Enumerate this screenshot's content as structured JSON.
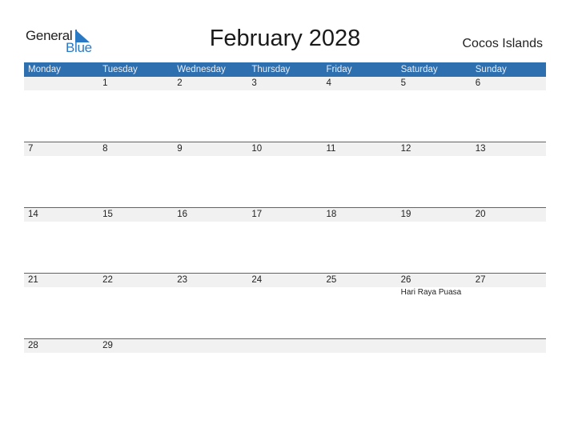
{
  "logo": {
    "word1": "General",
    "word2": "Blue"
  },
  "header": {
    "title": "February 2028",
    "country": "Cocos Islands"
  },
  "colors": {
    "accent": "#2E6FB0",
    "strip": "#f1f1f1",
    "logo_blue": "#2a79c4"
  },
  "weekdays": [
    "Monday",
    "Tuesday",
    "Wednesday",
    "Thursday",
    "Friday",
    "Saturday",
    "Sunday"
  ],
  "weeks": [
    {
      "days": [
        {
          "n": "",
          "ev": ""
        },
        {
          "n": "1",
          "ev": ""
        },
        {
          "n": "2",
          "ev": ""
        },
        {
          "n": "3",
          "ev": ""
        },
        {
          "n": "4",
          "ev": ""
        },
        {
          "n": "5",
          "ev": ""
        },
        {
          "n": "6",
          "ev": ""
        }
      ]
    },
    {
      "days": [
        {
          "n": "7",
          "ev": ""
        },
        {
          "n": "8",
          "ev": ""
        },
        {
          "n": "9",
          "ev": ""
        },
        {
          "n": "10",
          "ev": ""
        },
        {
          "n": "11",
          "ev": ""
        },
        {
          "n": "12",
          "ev": ""
        },
        {
          "n": "13",
          "ev": ""
        }
      ]
    },
    {
      "days": [
        {
          "n": "14",
          "ev": ""
        },
        {
          "n": "15",
          "ev": ""
        },
        {
          "n": "16",
          "ev": ""
        },
        {
          "n": "17",
          "ev": ""
        },
        {
          "n": "18",
          "ev": ""
        },
        {
          "n": "19",
          "ev": ""
        },
        {
          "n": "20",
          "ev": ""
        }
      ]
    },
    {
      "days": [
        {
          "n": "21",
          "ev": ""
        },
        {
          "n": "22",
          "ev": ""
        },
        {
          "n": "23",
          "ev": ""
        },
        {
          "n": "24",
          "ev": ""
        },
        {
          "n": "25",
          "ev": ""
        },
        {
          "n": "26",
          "ev": "Hari Raya Puasa"
        },
        {
          "n": "27",
          "ev": ""
        }
      ]
    },
    {
      "days": [
        {
          "n": "28",
          "ev": ""
        },
        {
          "n": "29",
          "ev": ""
        },
        {
          "n": "",
          "ev": ""
        },
        {
          "n": "",
          "ev": ""
        },
        {
          "n": "",
          "ev": ""
        },
        {
          "n": "",
          "ev": ""
        },
        {
          "n": "",
          "ev": ""
        }
      ]
    }
  ]
}
